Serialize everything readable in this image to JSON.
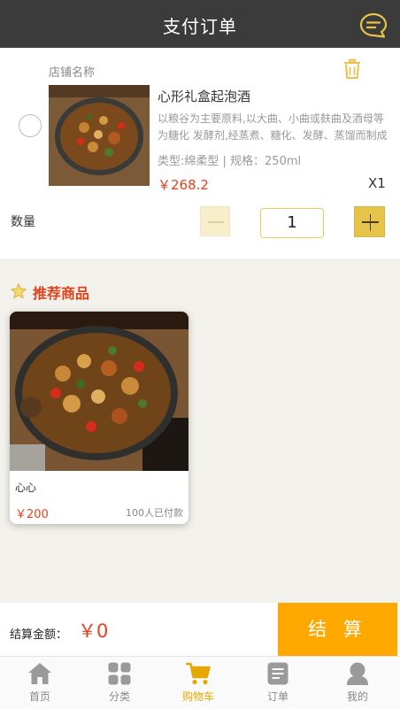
{
  "header": {
    "title": "支付订单",
    "message_icon": "message-icon"
  },
  "cart": {
    "shop_name": "店铺名称",
    "product": {
      "name": "心形礼盒起泡酒",
      "description": "以粮谷为主要原料,以大曲、小曲或麸曲及酒母等为糖化 发酵剂,经蒸煮、糖化、发酵、蒸馏而制成",
      "spec": "类型:绵柔型 | 规格：250ml",
      "price": "￥268.2",
      "count": "X1"
    },
    "quantity_label": "数量",
    "quantity_value": "1"
  },
  "recommend": {
    "title": "推荐商品",
    "items": [
      {
        "name": "心心",
        "price": "￥200",
        "sold": "100人已付款"
      }
    ]
  },
  "checkout": {
    "total_label": "结算金额：",
    "total_value": "￥0",
    "pay_label": "结 算"
  },
  "tabbar": {
    "items": [
      {
        "label": "首页",
        "icon": "home-icon"
      },
      {
        "label": "分类",
        "icon": "category-icon"
      },
      {
        "label": "购物车",
        "icon": "cart-icon",
        "active": true
      },
      {
        "label": "订单",
        "icon": "order-icon"
      },
      {
        "label": "我的",
        "icon": "profile-icon"
      }
    ]
  },
  "colors": {
    "accent": "#ffa900",
    "price": "#e8401c",
    "header": "#3b3b3b",
    "active_tab": "#e6a800"
  }
}
